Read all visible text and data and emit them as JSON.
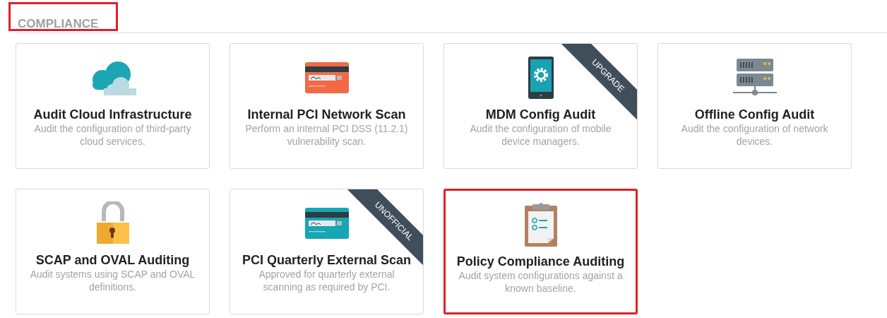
{
  "section": {
    "title": "COMPLIANCE",
    "highlighted": true
  },
  "cards": [
    {
      "kind": "cloud",
      "title": "Audit Cloud Infrastructure",
      "description": "Audit the configuration of third-party cloud services.",
      "highlighted": false
    },
    {
      "kind": "card-orange",
      "title": "Internal PCI Network Scan",
      "description": "Perform an internal PCI DSS (11.2.1) vulnerability scan.",
      "highlighted": false
    },
    {
      "kind": "phone",
      "title": "MDM Config Audit",
      "description": "Audit the configuration of mobile device managers.",
      "ribbon": "UPGRADE",
      "highlighted": false
    },
    {
      "kind": "server",
      "title": "Offline Config Audit",
      "description": "Audit the configuration of network devices.",
      "highlighted": false
    },
    {
      "kind": "lock",
      "title": "SCAP and OVAL Auditing",
      "description": "Audit systems using SCAP and OVAL definitions.",
      "highlighted": false
    },
    {
      "kind": "card-teal",
      "title": "PCI Quarterly External Scan",
      "description": "Approved for quarterly external scanning as required by PCI.",
      "ribbon": "UNOFFICIAL",
      "highlighted": false
    },
    {
      "kind": "clipboard",
      "title": "Policy Compliance Auditing",
      "description": "Audit system configurations against a known baseline.",
      "highlighted": true
    }
  ]
}
